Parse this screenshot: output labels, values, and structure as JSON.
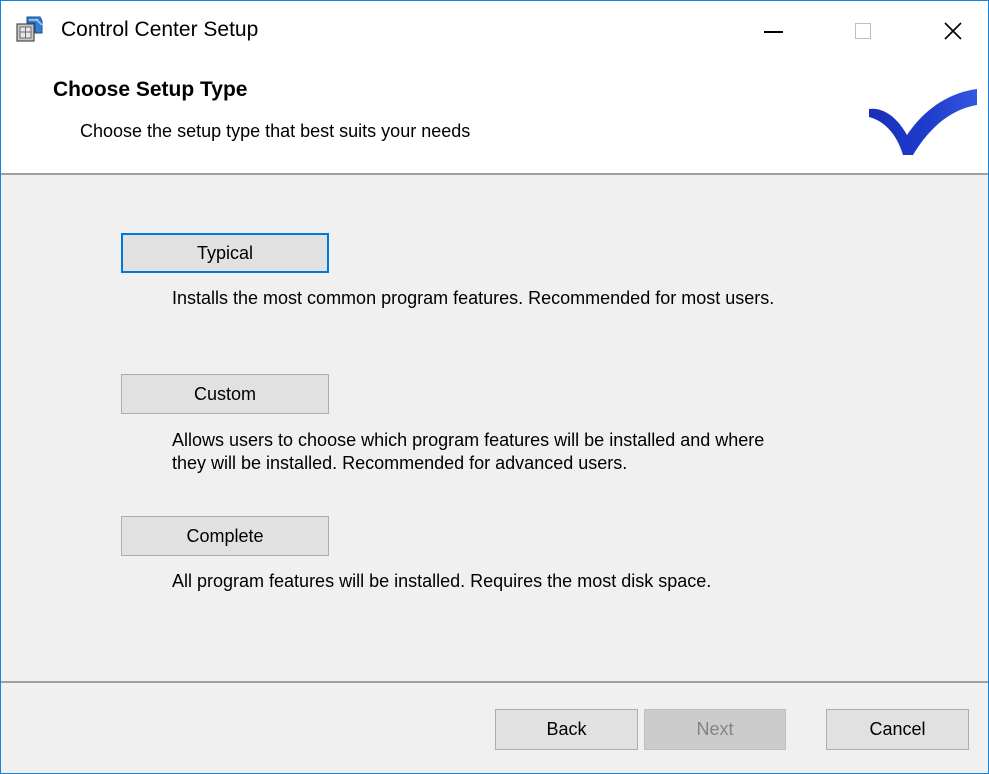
{
  "window": {
    "title": "Control Center Setup",
    "controls": {
      "minimize": "minimize",
      "maximize": "maximize",
      "close": "close"
    }
  },
  "header": {
    "title": "Choose Setup Type",
    "subtitle": "Choose the setup type that best suits your needs",
    "logo_color": "#1a3fc7"
  },
  "options": [
    {
      "label": "Typical",
      "description": [
        "Installs the most common program features. Recommended for most users."
      ]
    },
    {
      "label": "Custom",
      "description": [
        "Allows users to choose which program features will be installed and where",
        "they will be installed. Recommended for advanced users."
      ]
    },
    {
      "label": "Complete",
      "description": [
        "All program features will be installed. Requires the most disk space."
      ]
    }
  ],
  "footer": {
    "back": "Back",
    "next": "Next",
    "cancel": "Cancel"
  },
  "colors": {
    "accent": "#0078d7",
    "window_border": "#1883d7",
    "disabled_text": "#838383"
  },
  "icons": {
    "app": "installer-package-icon",
    "close": "close-icon",
    "minimize": "minimize-icon",
    "maximize": "maximize-icon"
  }
}
